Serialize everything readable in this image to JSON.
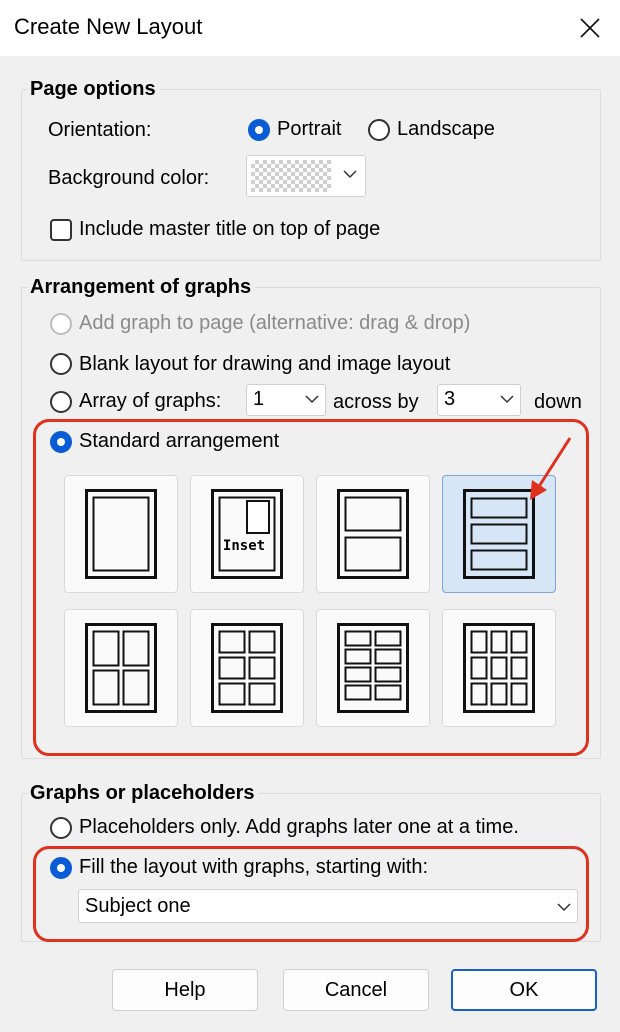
{
  "window": {
    "title": "Create New Layout"
  },
  "page_options": {
    "group_title": "Page options",
    "orientation_label": "Orientation:",
    "portrait_label": "Portrait",
    "landscape_label": "Landscape",
    "orientation_selected": "Portrait",
    "background_label": "Background color:",
    "background_value": "transparent",
    "master_title_label": "Include master title on top of page",
    "master_title_checked": false
  },
  "arrangement": {
    "group_title": "Arrangement of graphs",
    "add_graph_label": "Add graph to page (alternative: drag & drop)",
    "blank_label": "Blank layout for drawing and image layout",
    "array_label": "Array of graphs:",
    "array_across_value": "1",
    "across_by_label": "across by",
    "array_down_value": "3",
    "down_label": "down",
    "standard_label": "Standard arrangement",
    "selected_option": "Standard arrangement",
    "tiles": [
      {
        "name": "single-graph"
      },
      {
        "name": "graph-with-inset",
        "label": "Inset"
      },
      {
        "name": "two-rows"
      },
      {
        "name": "three-rows",
        "selected": true
      },
      {
        "name": "two-by-two"
      },
      {
        "name": "two-by-three"
      },
      {
        "name": "two-by-four"
      },
      {
        "name": "three-by-three"
      }
    ]
  },
  "graphs_or_placeholders": {
    "group_title": "Graphs or placeholders",
    "placeholders_label": "Placeholders only. Add graphs later one at a time.",
    "fill_label": "Fill the layout with graphs, starting with:",
    "fill_selected": true,
    "starting_with_value": "Subject one"
  },
  "buttons": {
    "help": "Help",
    "cancel": "Cancel",
    "ok": "OK"
  },
  "colors": {
    "accent": "#0a5bd6",
    "highlight": "#e0301e",
    "selected_tile": "#d6e6f6"
  }
}
